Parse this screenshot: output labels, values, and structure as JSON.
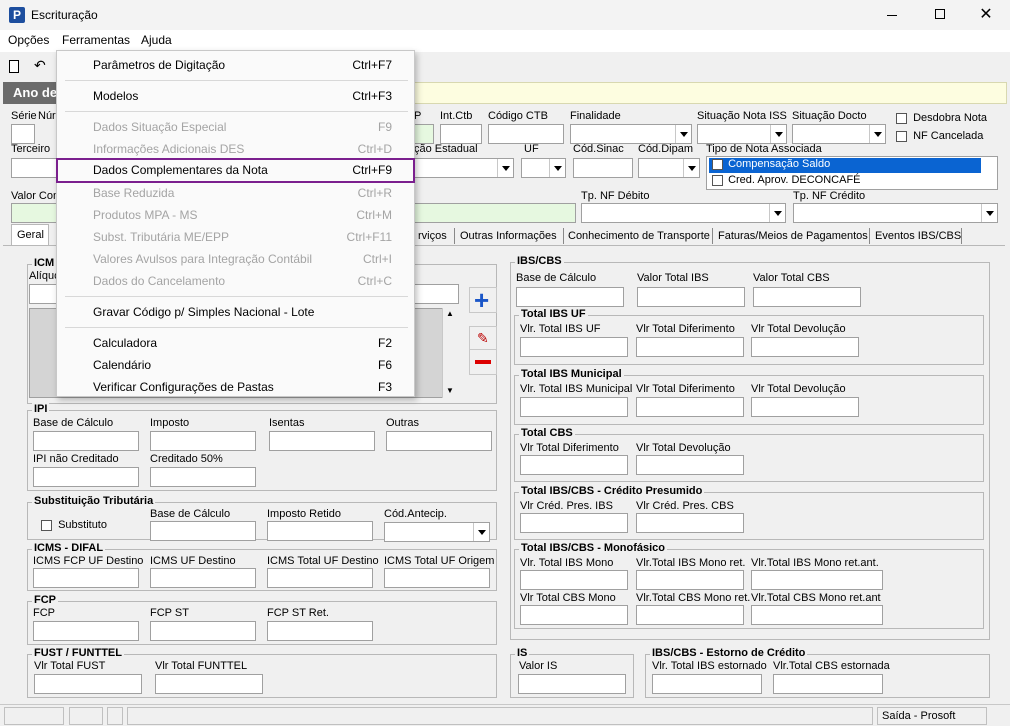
{
  "window": {
    "title": "Escrituração"
  },
  "menubar": {
    "opcoes": "Opções",
    "ferramentas": "Ferramentas",
    "ajuda": "Ajuda"
  },
  "dropdown": {
    "items": [
      {
        "label": "Parâmetros de Digitação",
        "shortcut": "Ctrl+F7"
      },
      {
        "label": "Modelos",
        "shortcut": "Ctrl+F3"
      },
      {
        "label": "Dados Situação Especial",
        "shortcut": "F9"
      },
      {
        "label": "Informações Adicionais DES",
        "shortcut": "Ctrl+D"
      },
      {
        "label": "Dados Complementares da Nota",
        "shortcut": "Ctrl+F9"
      },
      {
        "label": "Base Reduzida",
        "shortcut": "Ctrl+R"
      },
      {
        "label": "Produtos MPA - MS",
        "shortcut": "Ctrl+M"
      },
      {
        "label": "Subst. Tributária ME/EPP",
        "shortcut": "Ctrl+F11"
      },
      {
        "label": "Valores Avulsos para Integração Contábil",
        "shortcut": "Ctrl+I"
      },
      {
        "label": "Dados do Cancelamento",
        "shortcut": "Ctrl+C"
      },
      {
        "label": "Gravar Código p/ Simples Nacional - Lote",
        "shortcut": ""
      },
      {
        "label": "Calculadora",
        "shortcut": "F2"
      },
      {
        "label": "Calendário",
        "shortcut": "F6"
      },
      {
        "label": "Verificar Configurações de Pastas",
        "shortcut": "F3"
      }
    ]
  },
  "header": {
    "banner": "Ano de"
  },
  "form": {
    "serie": "Série",
    "numero_partial": "Núr",
    "p_partial": "P",
    "int_ctb": "Int.Ctb",
    "codigo_ctb": "Código CTB",
    "finalidade": "Finalidade",
    "situacao_nota_iss": "Situação Nota ISS",
    "situacao_docto": "Situação Docto",
    "desdobra_nota": "Desdobra Nota",
    "nf_cancelada": "NF Cancelada",
    "terceiro": "Terceiro",
    "estadual_partial": "ção Estadual",
    "uf": "UF",
    "cod_sinac": "Cód.Sinac",
    "cod_dipam": "Cód.Dipam",
    "tipo_nota_associada": "Tipo de Nota Associada",
    "assoc_options": [
      "Compensação Saldo",
      "Cred. Aprov. DECONCAFÉ"
    ],
    "valor_con_partial": "Valor Con",
    "tp_nf_debito": "Tp. NF Débito",
    "tp_nf_credito": "Tp. NF Crédito"
  },
  "tabs": {
    "geral": "Geral",
    "servicos_partial": "rviços",
    "outras": "Outras Informações",
    "conhecimento": "Conhecimento de Transporte",
    "faturas": "Faturas/Meios de Pagamentos",
    "eventos": "Eventos IBS/CBS"
  },
  "left": {
    "icms_partial": "ICM",
    "aliquota_partial": "Alíquo",
    "ipi": {
      "title": "IPI",
      "base": "Base de Cálculo",
      "imposto": "Imposto",
      "isentas": "Isentas",
      "outras": "Outras",
      "nao_creditado": "IPI não Creditado",
      "creditado50": "Creditado 50%"
    },
    "st": {
      "title": "Substituição Tributária",
      "substituto": "Substituto",
      "base": "Base de Cálculo",
      "imposto_retido": "Imposto Retido",
      "cod_antecip": "Cód.Antecip."
    },
    "difal": {
      "title": "ICMS - DIFAL",
      "fcp_uf_destino": "ICMS FCP UF Destino",
      "uf_destino": "ICMS UF Destino",
      "total_uf_destino": "ICMS Total UF Destino",
      "total_uf_origem": "ICMS Total UF Origem"
    },
    "fcp": {
      "title": "FCP",
      "fcp": "FCP",
      "fcp_st": "FCP ST",
      "fcp_st_ret": "FCP ST Ret."
    },
    "fust": {
      "title": "FUST / FUNTTEL",
      "vlr_fust": "Vlr Total FUST",
      "vlr_funttel": "Vlr Total FUNTTEL"
    }
  },
  "right": {
    "ibscbs": {
      "title": "IBS/CBS",
      "base": "Base de Cálculo",
      "valor_ibs": "Valor Total IBS",
      "valor_cbs": "Valor Total CBS"
    },
    "total_ibs_uf": {
      "title": "Total IBS UF",
      "a": "Vlr. Total IBS UF",
      "b": "Vlr Total Diferimento",
      "c": "Vlr Total Devolução"
    },
    "total_ibs_mun": {
      "title": "Total IBS Municipal",
      "a": "Vlr. Total IBS Municipal",
      "b": "Vlr Total Diferimento",
      "c": "Vlr Total Devolução"
    },
    "total_cbs": {
      "title": "Total CBS",
      "a": "Vlr Total Diferimento",
      "b": "Vlr Total Devolução"
    },
    "presumido": {
      "title": "Total IBS/CBS - Crédito Presumido",
      "a": "Vlr Créd. Pres. IBS",
      "b": "Vlr Créd. Pres. CBS"
    },
    "monofasico": {
      "title": "Total IBS/CBS - Monofásico",
      "a": "Vlr. Total IBS Mono",
      "b": "Vlr.Total IBS Mono ret.",
      "c": "Vlr.Total IBS Mono ret.ant.",
      "d": "Vlr Total CBS Mono",
      "e": "Vlr.Total CBS Mono ret.",
      "f": "Vlr.Total CBS Mono ret.ant"
    },
    "is": {
      "title": "IS",
      "valor": "Valor IS"
    },
    "estorno": {
      "title": "IBS/CBS - Estorno de Crédito",
      "a": "Vlr. Total IBS estornado",
      "b": "Vlr.Total CBS estornada"
    }
  },
  "status": {
    "right": "Saída - Prosoft"
  }
}
